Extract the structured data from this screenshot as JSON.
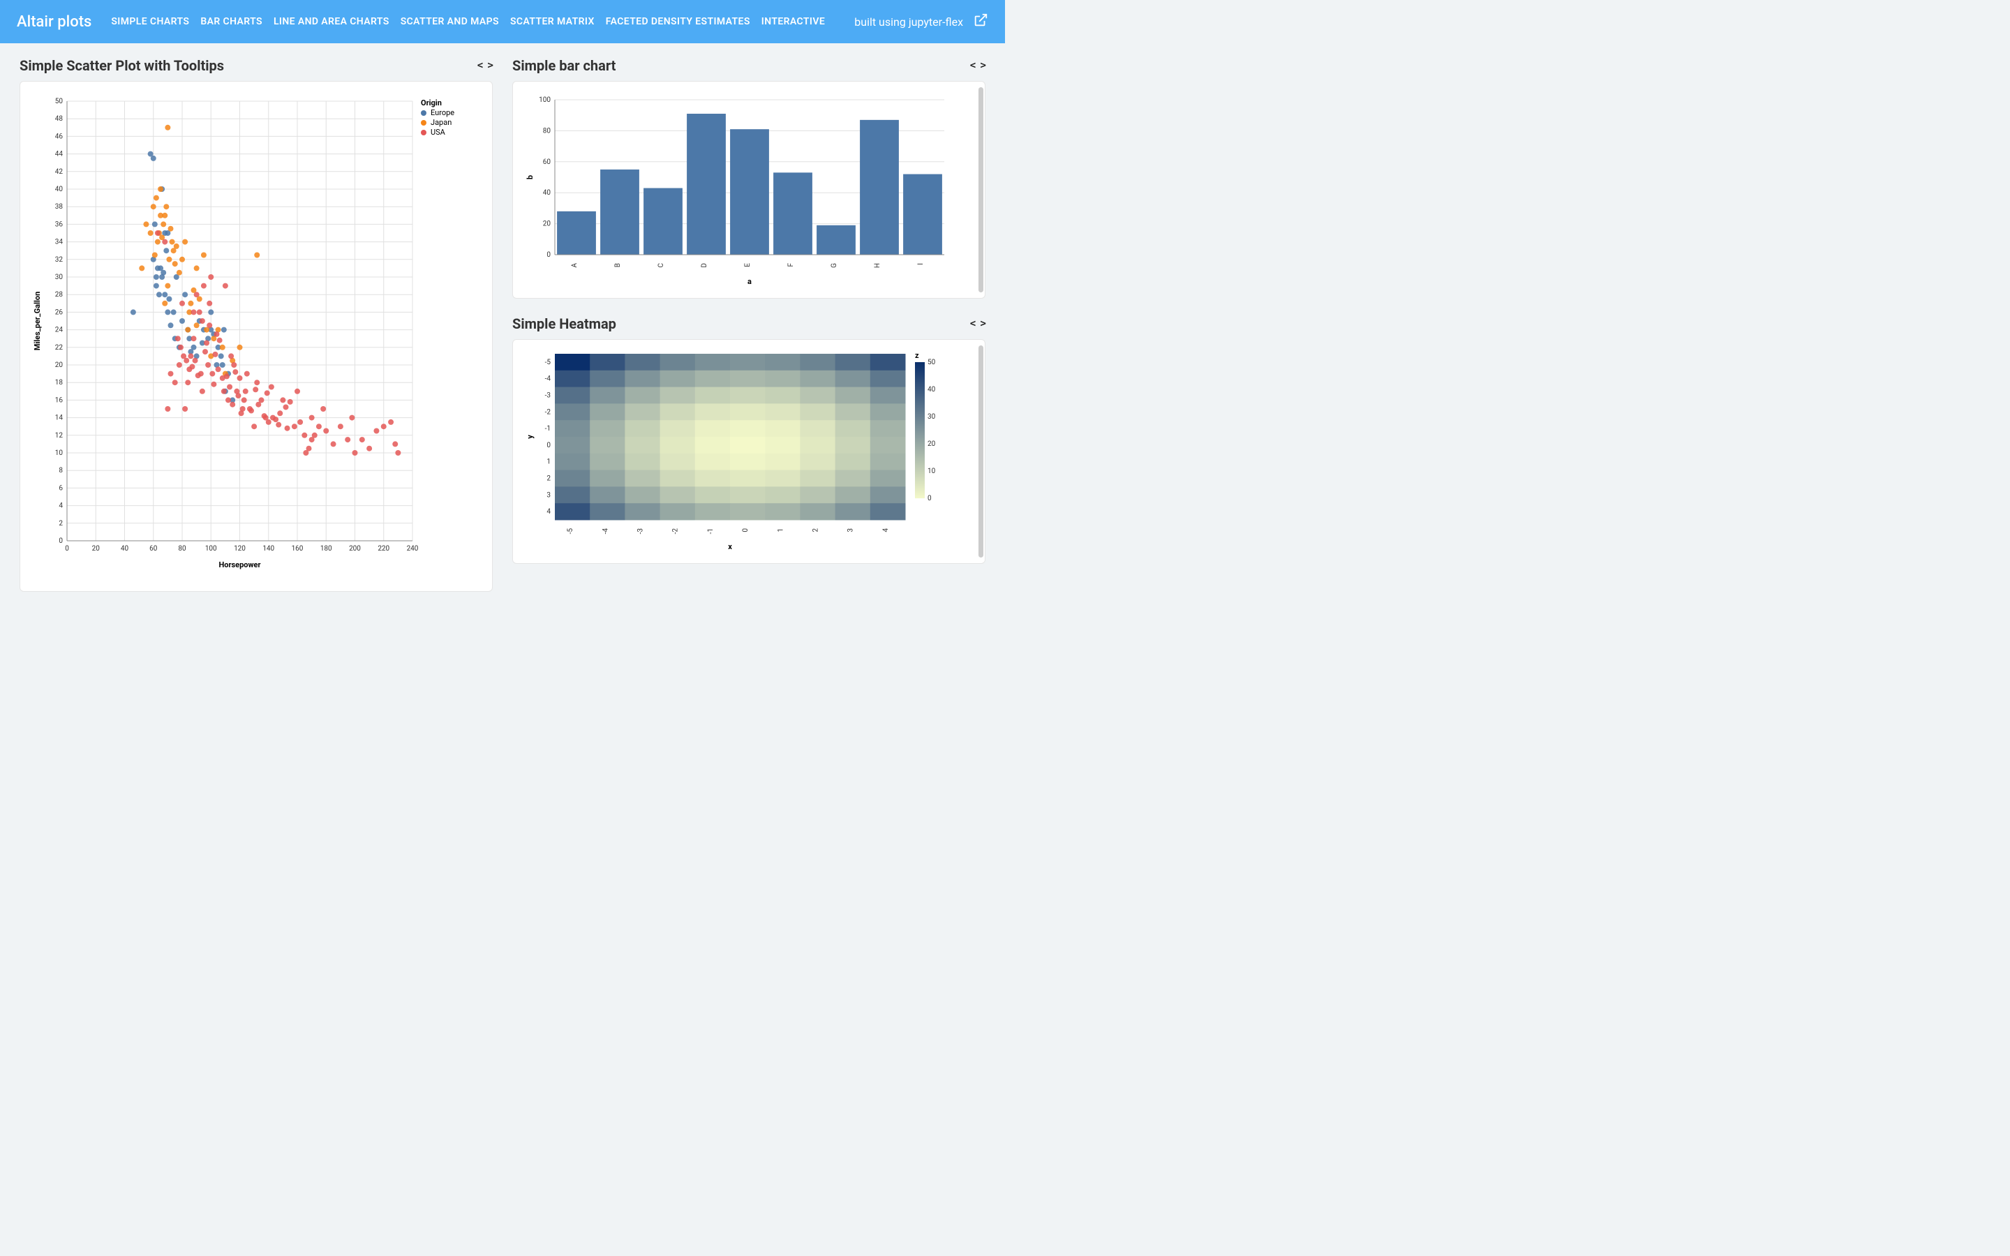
{
  "header": {
    "title": "Altair plots",
    "nav": [
      "SIMPLE CHARTS",
      "BAR CHARTS",
      "LINE AND AREA CHARTS",
      "SCATTER AND MAPS",
      "SCATTER MATRIX",
      "FACETED DENSITY ESTIMATES",
      "INTERACTIVE"
    ],
    "right_text": "built using jupyter-flex"
  },
  "cards": {
    "scatter": {
      "title": "Simple Scatter Plot with Tooltips"
    },
    "bar": {
      "title": "Simple bar chart"
    },
    "heatmap": {
      "title": "Simple Heatmap"
    }
  },
  "chart_data": [
    {
      "id": "scatter",
      "type": "scatter",
      "title": "Simple Scatter Plot with Tooltips",
      "xlabel": "Horsepower",
      "ylabel": "Miles_per_Gallon",
      "xlim": [
        0,
        240
      ],
      "ylim": [
        0,
        50
      ],
      "xticks": [
        0,
        20,
        40,
        60,
        80,
        100,
        120,
        140,
        160,
        180,
        200,
        220,
        240
      ],
      "yticks": [
        0,
        2,
        4,
        6,
        8,
        10,
        12,
        14,
        16,
        18,
        20,
        22,
        24,
        26,
        28,
        30,
        32,
        34,
        36,
        38,
        40,
        42,
        44,
        46,
        48,
        50
      ],
      "legend_title": "Origin",
      "series": [
        {
          "name": "Europe",
          "color": "#4c78a8",
          "points": [
            [
              46,
              26
            ],
            [
              60,
              32
            ],
            [
              61,
              36
            ],
            [
              62,
              30
            ],
            [
              63,
              31
            ],
            [
              64,
              28
            ],
            [
              65,
              31
            ],
            [
              66,
              30
            ],
            [
              67,
              30.5
            ],
            [
              68,
              28
            ],
            [
              68,
              35
            ],
            [
              69,
              33
            ],
            [
              70,
              26
            ],
            [
              71,
              27.5
            ],
            [
              72,
              24.5
            ],
            [
              74,
              26
            ],
            [
              75,
              23
            ],
            [
              76,
              30
            ],
            [
              78,
              22
            ],
            [
              80,
              25
            ],
            [
              82,
              28
            ],
            [
              84,
              24
            ],
            [
              85,
              23
            ],
            [
              86,
              21.5
            ],
            [
              88,
              22
            ],
            [
              90,
              21
            ],
            [
              92,
              25
            ],
            [
              94,
              22.5
            ],
            [
              95,
              24
            ],
            [
              98,
              23
            ],
            [
              100,
              26
            ],
            [
              102,
              23.5
            ],
            [
              105,
              22
            ],
            [
              108,
              20
            ],
            [
              110,
              17
            ],
            [
              112,
              19
            ],
            [
              115,
              16
            ],
            [
              58,
              44
            ],
            [
              60,
              43.5
            ],
            [
              62,
              29
            ],
            [
              66,
              40
            ],
            [
              70,
              35
            ],
            [
              100,
              24
            ],
            [
              104,
              20
            ],
            [
              107,
              21
            ],
            [
              109,
              24
            ]
          ]
        },
        {
          "name": "Japan",
          "color": "#f58518",
          "points": [
            [
              52,
              31
            ],
            [
              58,
              35
            ],
            [
              60,
              38
            ],
            [
              61,
              32.5
            ],
            [
              62,
              39
            ],
            [
              63,
              34
            ],
            [
              64,
              35
            ],
            [
              65,
              40
            ],
            [
              66,
              34.5
            ],
            [
              67,
              36
            ],
            [
              68,
              37
            ],
            [
              68,
              27
            ],
            [
              69,
              38
            ],
            [
              70,
              29
            ],
            [
              70,
              47
            ],
            [
              71,
              32
            ],
            [
              72,
              35.5
            ],
            [
              73,
              34
            ],
            [
              74,
              33
            ],
            [
              75,
              31.5
            ],
            [
              76,
              33.5
            ],
            [
              78,
              30.5
            ],
            [
              80,
              32
            ],
            [
              82,
              34
            ],
            [
              84,
              24
            ],
            [
              85,
              26
            ],
            [
              86,
              27
            ],
            [
              88,
              28.5
            ],
            [
              90,
              31
            ],
            [
              90,
              24.5
            ],
            [
              92,
              27.5
            ],
            [
              95,
              32.5
            ],
            [
              97,
              24
            ],
            [
              100,
              21
            ],
            [
              102,
              23
            ],
            [
              105,
              24
            ],
            [
              108,
              22
            ],
            [
              110,
              19
            ],
            [
              115,
              20.5
            ],
            [
              120,
              22
            ],
            [
              132,
              32.5
            ],
            [
              55,
              36
            ],
            [
              65,
              37
            ]
          ]
        },
        {
          "name": "USA",
          "color": "#e45756",
          "points": [
            [
              63,
              35
            ],
            [
              68,
              34
            ],
            [
              70,
              15
            ],
            [
              72,
              19
            ],
            [
              75,
              18
            ],
            [
              78,
              20
            ],
            [
              80,
              27
            ],
            [
              82,
              15
            ],
            [
              84,
              18
            ],
            [
              85,
              19.5
            ],
            [
              86,
              21
            ],
            [
              88,
              23
            ],
            [
              89,
              20.5
            ],
            [
              90,
              28
            ],
            [
              92,
              26
            ],
            [
              93,
              19
            ],
            [
              94,
              17
            ],
            [
              95,
              29
            ],
            [
              96,
              21.5
            ],
            [
              97,
              22.5
            ],
            [
              98,
              20
            ],
            [
              99,
              24.5
            ],
            [
              100,
              30
            ],
            [
              101,
              19
            ],
            [
              102,
              17.8
            ],
            [
              103,
              21.2
            ],
            [
              104,
              23.5
            ],
            [
              105,
              19.5
            ],
            [
              106,
              22.8
            ],
            [
              108,
              18.5
            ],
            [
              110,
              29
            ],
            [
              112,
              16
            ],
            [
              113,
              17.5
            ],
            [
              114,
              21
            ],
            [
              115,
              15.5
            ],
            [
              116,
              20
            ],
            [
              118,
              17
            ],
            [
              120,
              18.5
            ],
            [
              122,
              15
            ],
            [
              124,
              17
            ],
            [
              125,
              19
            ],
            [
              128,
              14.8
            ],
            [
              130,
              13
            ],
            [
              132,
              18
            ],
            [
              135,
              16
            ],
            [
              138,
              14
            ],
            [
              140,
              13.5
            ],
            [
              142,
              17.5
            ],
            [
              145,
              13.8
            ],
            [
              148,
              14.5
            ],
            [
              150,
              16
            ],
            [
              152,
              15.2
            ],
            [
              155,
              15.8
            ],
            [
              158,
              13
            ],
            [
              160,
              17
            ],
            [
              162,
              13.5
            ],
            [
              165,
              12
            ],
            [
              168,
              10.5
            ],
            [
              170,
              14
            ],
            [
              175,
              13
            ],
            [
              178,
              15
            ],
            [
              180,
              12.5
            ],
            [
              185,
              11
            ],
            [
              190,
              13
            ],
            [
              195,
              11.5
            ],
            [
              198,
              14
            ],
            [
              200,
              10
            ],
            [
              205,
              11.5
            ],
            [
              210,
              10.5
            ],
            [
              215,
              12.5
            ],
            [
              220,
              13
            ],
            [
              225,
              13.5
            ],
            [
              228,
              11
            ],
            [
              230,
              10
            ],
            [
              166,
              10
            ],
            [
              170,
              11.5
            ],
            [
              172,
              12
            ],
            [
              88,
              26
            ],
            [
              94,
              25
            ],
            [
              99,
              27
            ],
            [
              77,
              23
            ],
            [
              79,
              22
            ],
            [
              81,
              21
            ],
            [
              83,
              20.5
            ],
            [
              87,
              19.8
            ],
            [
              91,
              18.8
            ],
            [
              109,
              17
            ],
            [
              111,
              18.7
            ],
            [
              117,
              19.2
            ],
            [
              119,
              16.5
            ],
            [
              121,
              14.5
            ],
            [
              123,
              16
            ],
            [
              127,
              15
            ],
            [
              131,
              17.2
            ],
            [
              133,
              15.5
            ],
            [
              137,
              14.2
            ],
            [
              139,
              16.8
            ],
            [
              143,
              14
            ],
            [
              147,
              13.2
            ],
            [
              153,
              12.8
            ]
          ]
        }
      ]
    },
    {
      "id": "bar",
      "type": "bar",
      "title": "Simple bar chart",
      "xlabel": "a",
      "ylabel": "b",
      "categories": [
        "A",
        "B",
        "C",
        "D",
        "E",
        "F",
        "G",
        "H",
        "I"
      ],
      "values": [
        28,
        55,
        43,
        91,
        81,
        53,
        19,
        87,
        52
      ],
      "ylim": [
        0,
        100
      ],
      "yticks": [
        0,
        20,
        40,
        60,
        80,
        100
      ],
      "color": "#4c78a8"
    },
    {
      "id": "heatmap",
      "type": "heatmap",
      "title": "Simple Heatmap",
      "xlabel": "x",
      "ylabel": "y",
      "legend_title": "z",
      "x_categories": [
        -5,
        -4,
        -3,
        -2,
        -1,
        0,
        1,
        2,
        3,
        4
      ],
      "y_categories": [
        -5,
        -4,
        -3,
        -2,
        -1,
        0,
        1,
        2,
        3,
        4
      ],
      "z_ticks": [
        0,
        10,
        20,
        30,
        40,
        50
      ],
      "z_range": [
        0,
        50
      ],
      "color_low": "#f4f9c9",
      "color_high": "#0a2f6b",
      "grid": [
        [
          50,
          41,
          34,
          29,
          26,
          25,
          26,
          29,
          34,
          41
        ],
        [
          41,
          32,
          25,
          20,
          17,
          16,
          17,
          20,
          25,
          32
        ],
        [
          34,
          25,
          18,
          13,
          10,
          9,
          10,
          13,
          18,
          25
        ],
        [
          29,
          20,
          13,
          8,
          5,
          4,
          5,
          8,
          13,
          20
        ],
        [
          26,
          17,
          10,
          5,
          2,
          1,
          2,
          5,
          10,
          17
        ],
        [
          25,
          16,
          9,
          4,
          1,
          0,
          1,
          4,
          9,
          16
        ],
        [
          26,
          17,
          10,
          5,
          2,
          1,
          2,
          5,
          10,
          17
        ],
        [
          29,
          20,
          13,
          8,
          5,
          4,
          5,
          8,
          13,
          20
        ],
        [
          34,
          25,
          18,
          13,
          10,
          9,
          10,
          13,
          18,
          25
        ],
        [
          41,
          32,
          25,
          20,
          17,
          16,
          17,
          20,
          25,
          32
        ]
      ]
    }
  ]
}
